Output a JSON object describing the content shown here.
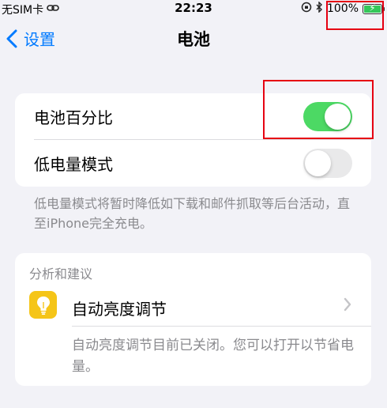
{
  "status_bar": {
    "carrier": "无SIM卡",
    "time": "22:23",
    "battery_percent": "100%",
    "battery_level": 1.0,
    "battery_color": "#34c759"
  },
  "nav": {
    "back_label": "设置",
    "title": "电池"
  },
  "settings": {
    "battery_percentage": {
      "label": "电池百分比",
      "on": true
    },
    "low_power_mode": {
      "label": "低电量模式",
      "on": false
    },
    "footnote": "低电量模式将暂时降低如下载和邮件抓取等后台活动，直至iPhone完全充电。"
  },
  "analysis": {
    "header": "分析和建议",
    "item_label": "自动亮度调节",
    "item_icon": "lightbulb-icon",
    "item_desc": "自动亮度调节目前已关闭。您可以打开以节省电量。"
  },
  "colors": {
    "accent": "#007aff",
    "toggle_on": "#4cd964",
    "annotation_red": "#e60012"
  }
}
